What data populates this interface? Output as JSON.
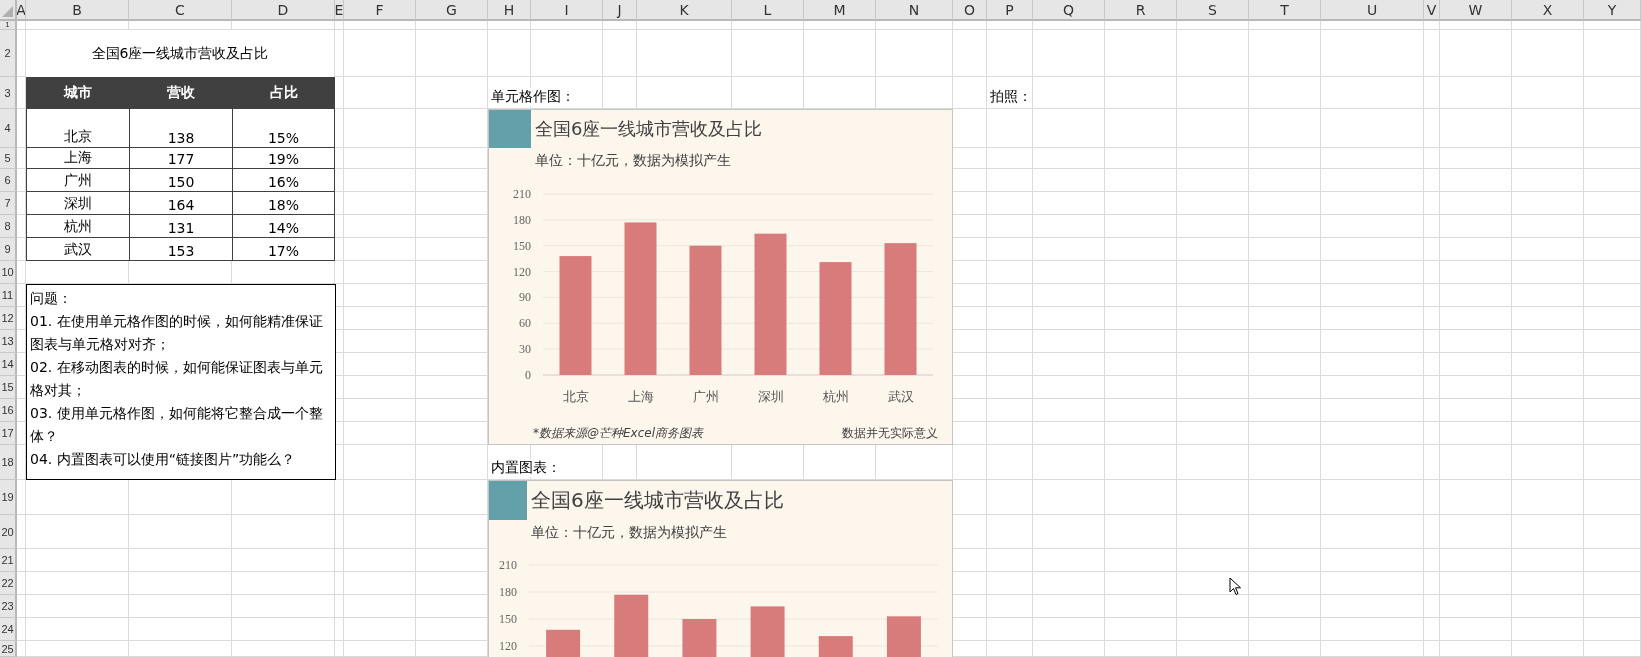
{
  "column_headers": [
    "A",
    "B",
    "C",
    "D",
    "E",
    "F",
    "G",
    "H",
    "I",
    "J",
    "K",
    "L",
    "M",
    "N",
    "O",
    "P",
    "Q",
    "R",
    "S",
    "T",
    "U",
    "V",
    "W",
    "X",
    "Y"
  ],
  "row_headers": [
    "1",
    "2",
    "3",
    "4",
    "5",
    "6",
    "7",
    "8",
    "9",
    "10",
    "11",
    "12",
    "13",
    "14",
    "15",
    "16",
    "17",
    "18",
    "19",
    "20",
    "21",
    "22",
    "23",
    "24",
    "25"
  ],
  "table_title": "全国6座一线城市营收及占比",
  "table": {
    "columns": [
      "城市",
      "营收",
      "占比"
    ],
    "rows": [
      [
        "北京",
        "138",
        "15%"
      ],
      [
        "上海",
        "177",
        "19%"
      ],
      [
        "广州",
        "150",
        "16%"
      ],
      [
        "深圳",
        "164",
        "18%"
      ],
      [
        "杭州",
        "131",
        "14%"
      ],
      [
        "武汉",
        "153",
        "17%"
      ]
    ]
  },
  "questions": [
    "问题：",
    "01. 在使用单元格作图的时候，如何能精准保证图表与单元格对对齐；",
    "02. 在移动图表的时候，如何能保证图表与单元格对其；",
    "03. 使用单元格作图，如何能将它整合成一个整体？",
    "04. 内置图表可以使用“链接图片”功能么？"
  ],
  "labels": [
    "单元格作图：",
    "内置图表：",
    "拍照："
  ],
  "charts": [
    {
      "title": "全国6座一线城市营收及占比",
      "subtitle": "单位：十亿元，数据为模拟产生",
      "source": "*数据来源@芒种Excel商务图表",
      "note": "数据并无实际意义",
      "chart_data": {
        "type": "bar",
        "categories": [
          "北京",
          "上海",
          "广州",
          "深圳",
          "杭州",
          "武汉"
        ],
        "series": [
          {
            "color": "#d87b7b",
            "values": [
              138,
              177,
              150,
              164,
              131,
              153
            ]
          }
        ],
        "ylim": [
          0,
          210
        ],
        "yticks": [
          0,
          30,
          60,
          90,
          120,
          150,
          180,
          210
        ],
        "grid": true
      }
    },
    {
      "title": "全国6座一线城市营收及占比",
      "subtitle": "单位：十亿元，数据为模拟产生",
      "chart_data": {
        "type": "bar",
        "series": [
          {
            "color": "#d87b7b",
            "values": [
              138,
              177,
              150,
              164,
              131,
              153
            ]
          }
        ],
        "ylim": [
          0,
          210
        ],
        "yticks": [
          120,
          150,
          180,
          210
        ],
        "grid": true
      }
    }
  ]
}
